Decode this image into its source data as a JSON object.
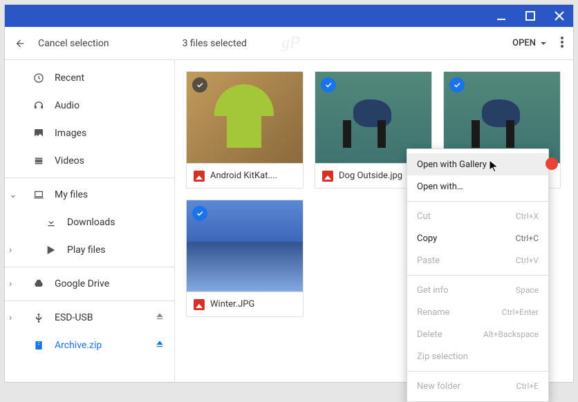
{
  "toolbar": {
    "cancel_label": "Cancel selection",
    "status": "3 files selected",
    "open_label": "OPEN",
    "watermark": "gP"
  },
  "sidebar": {
    "recent": "Recent",
    "audio": "Audio",
    "images": "Images",
    "videos": "Videos",
    "my_files": "My files",
    "downloads": "Downloads",
    "play_files": "Play files",
    "google_drive": "Google Drive",
    "esd_usb": "ESD-USB",
    "archive": "Archive.zip"
  },
  "files": {
    "0": {
      "name": "Android KitKat...."
    },
    "1": {
      "name": "Dog Outside.jpg"
    },
    "2": {
      "name": ""
    },
    "3": {
      "name": "Winter.JPG"
    }
  },
  "menu": {
    "open_gallery": "Open with Gallery",
    "open_with": "Open with…",
    "cut": "Cut",
    "cut_s": "Ctrl+X",
    "copy": "Copy",
    "copy_s": "Ctrl+C",
    "paste": "Paste",
    "paste_s": "Ctrl+V",
    "get_info": "Get info",
    "get_info_s": "Space",
    "rename": "Rename",
    "rename_s": "Ctrl+Enter",
    "delete": "Delete",
    "delete_s": "Alt+Backspace",
    "zip": "Zip selection",
    "new_folder": "New folder",
    "new_folder_s": "Ctrl+E"
  }
}
